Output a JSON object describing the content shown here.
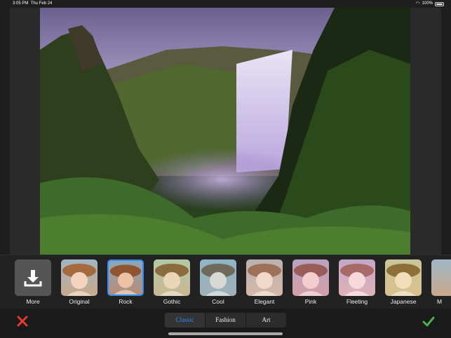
{
  "status_bar": {
    "time": "3:05 PM",
    "date": "Thu Feb 24",
    "battery": "100%",
    "wifi_icon": "wifi-icon"
  },
  "filters": {
    "more_label": "More",
    "items": [
      {
        "label": "Original"
      },
      {
        "label": "Rock",
        "selected": true
      },
      {
        "label": "Gothic"
      },
      {
        "label": "Cool"
      },
      {
        "label": "Elegant"
      },
      {
        "label": "Pink"
      },
      {
        "label": "Fleeting"
      },
      {
        "label": "Japanese"
      },
      {
        "label": "M"
      }
    ]
  },
  "tabs": [
    {
      "label": "Classic",
      "active": true
    },
    {
      "label": "Fashion"
    },
    {
      "label": "Art"
    }
  ],
  "colors": {
    "accent": "#2d8cff",
    "cancel": "#e53935",
    "confirm": "#4caf50"
  }
}
